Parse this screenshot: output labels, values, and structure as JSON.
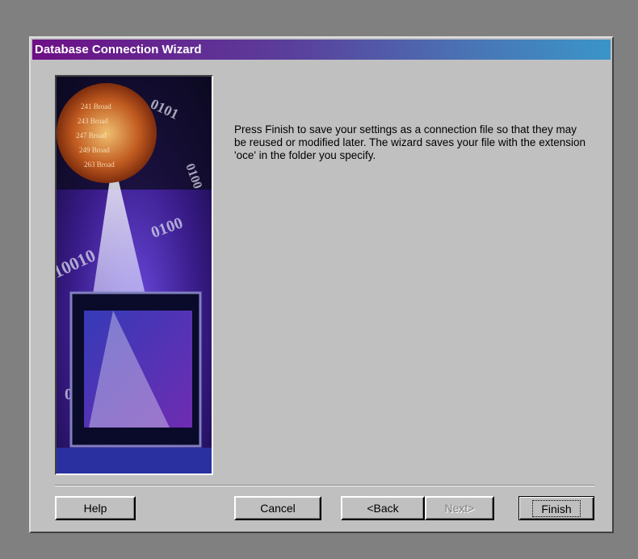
{
  "window": {
    "title": "Database Connection Wizard"
  },
  "body": {
    "message": "Press Finish to save your settings as a connection file so that they may be reused or modified later. The wizard saves your file with the extension 'oce' in the folder you specify."
  },
  "buttons": {
    "help": "Help",
    "cancel": "Cancel",
    "back": "<Back",
    "next": "Next>",
    "finish": "Finish"
  },
  "state": {
    "next_enabled": false,
    "default_button": "finish"
  },
  "colors": {
    "face": "#c0c0c0",
    "title_gradient_start": "#6e0f86",
    "title_gradient_end": "#3a95c8",
    "desktop": "#808080"
  },
  "icons": {
    "side_image": "database-binary-monitor-illustration"
  }
}
